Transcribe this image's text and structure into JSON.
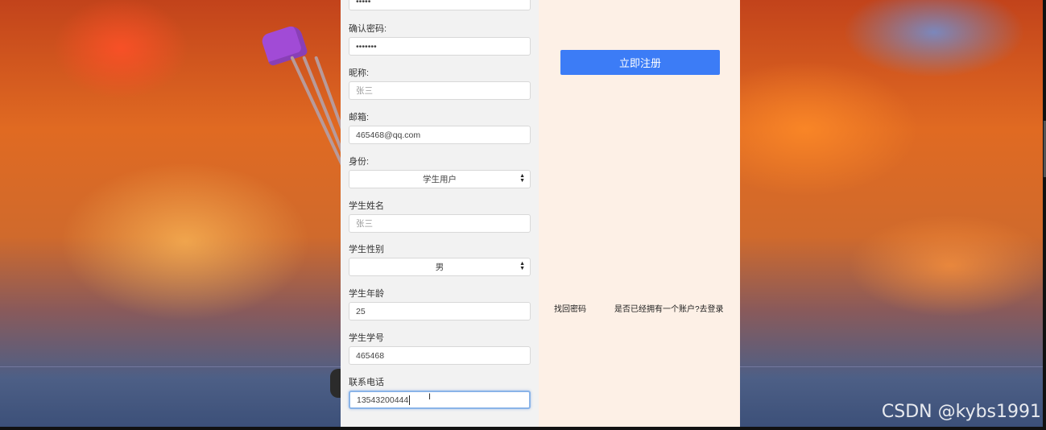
{
  "form": {
    "password_value": "•••••",
    "confirm_label": "确认密码:",
    "confirm_value": "•••••••",
    "nickname_label": "昵称:",
    "nickname_placeholder": "张三",
    "email_label": "邮箱:",
    "email_value": "465468@qq.com",
    "identity_label": "身份:",
    "identity_selected": "学生用户",
    "student_name_label": "学生姓名",
    "student_name_placeholder": "张三",
    "gender_label": "学生性别",
    "gender_selected": "男",
    "age_label": "学生年龄",
    "age_value": "25",
    "student_id_label": "学生学号",
    "student_id_value": "465468",
    "phone_label": "联系电话",
    "phone_value": "13543200444"
  },
  "side": {
    "register_button": "立即注册",
    "forgot_password": "找回密码",
    "login_link": "是否已经拥有一个账户?去登录"
  },
  "watermark": "CSDN @kybs1991",
  "icons": {
    "select_arrow": "chevron-up-down-icon",
    "text_cursor": "i-beam-cursor-icon"
  },
  "colors": {
    "button": "#3c7cf6",
    "form_panel": "#f2f2f2",
    "side_panel": "#fdf0e6"
  }
}
